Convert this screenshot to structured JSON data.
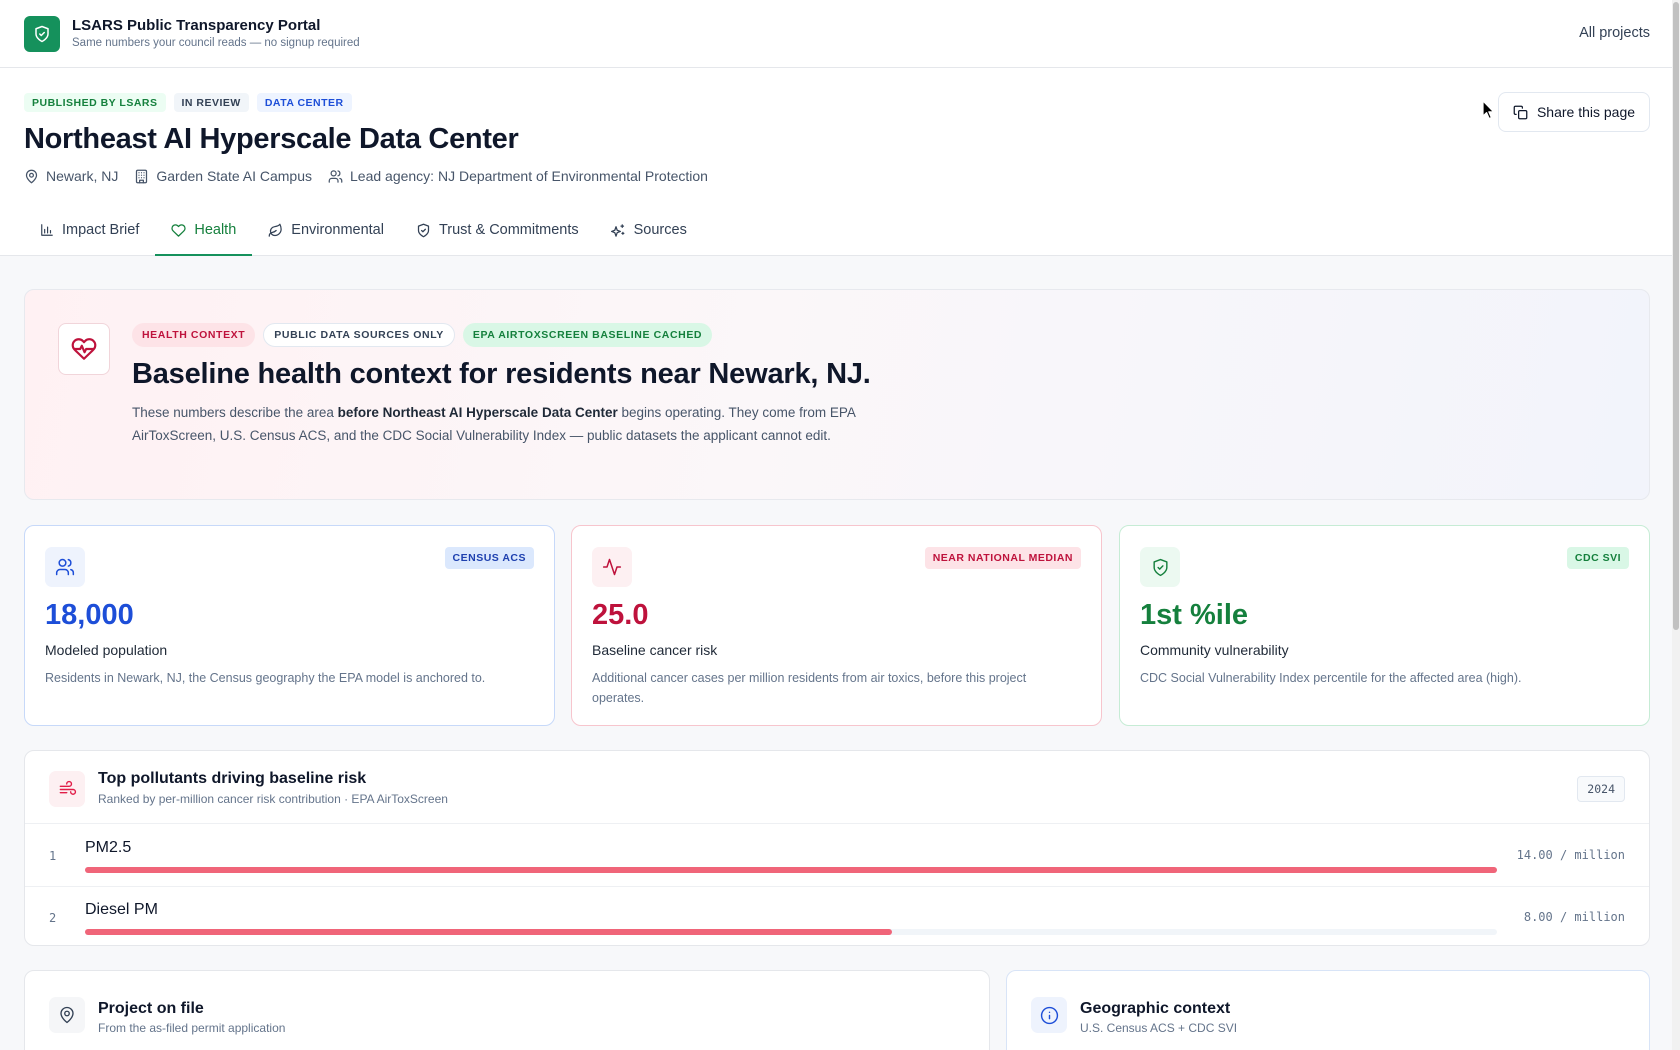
{
  "app": {
    "title": "LSARS Public Transparency Portal",
    "subtitle": "Same numbers your council reads — no signup required",
    "all_projects_link": "All projects"
  },
  "project": {
    "chips": [
      "PUBLISHED BY LSARS",
      "IN REVIEW",
      "DATA CENTER"
    ],
    "title": "Northeast AI Hyperscale Data Center",
    "location": "Newark, NJ",
    "campus": "Garden State AI Campus",
    "lead_agency": "Lead agency: NJ Department of Environmental Protection",
    "share_button": "Share this page"
  },
  "tabs": [
    {
      "label": "Impact Brief",
      "icon": "bar-chart-icon",
      "active": false
    },
    {
      "label": "Health",
      "icon": "heart-icon",
      "active": true
    },
    {
      "label": "Environmental",
      "icon": "leaf-icon",
      "active": false
    },
    {
      "label": "Trust & Commitments",
      "icon": "shield-check-icon",
      "active": false
    },
    {
      "label": "Sources",
      "icon": "sparkles-icon",
      "active": false
    }
  ],
  "hero": {
    "chips": [
      "HEALTH CONTEXT",
      "PUBLIC DATA SOURCES ONLY",
      "EPA AIRTOXSCREEN BASELINE CACHED"
    ],
    "title": "Baseline health context for residents near Newark, NJ.",
    "desc_pre": "These numbers describe the area ",
    "desc_bold": "before Northeast AI Hyperscale Data Center",
    "desc_post": " begins operating. They come from EPA AirToxScreen, U.S. Census ACS, and the CDC Social Vulnerability Index — public datasets the applicant cannot edit."
  },
  "stats": [
    {
      "badge": "CENSUS ACS",
      "value": "18,000",
      "label": "Modeled population",
      "desc": "Residents in Newark, NJ, the Census geography the EPA model is anchored to.",
      "icon": "users-icon",
      "color": "#1d4ed8"
    },
    {
      "badge": "NEAR NATIONAL MEDIAN",
      "value": "25.0",
      "label": "Baseline cancer risk",
      "desc": "Additional cancer cases per million residents from air toxics, before this project operates.",
      "icon": "activity-icon",
      "color": "#be123c"
    },
    {
      "badge": "CDC SVI",
      "value": "1st %ile",
      "label": "Community vulnerability",
      "desc": "CDC Social Vulnerability Index percentile for the affected area (high).",
      "icon": "shield-check-icon",
      "color": "#15803d"
    }
  ],
  "pollutants": {
    "title": "Top pollutants driving baseline risk",
    "subtitle": "Ranked by per-million cancer risk contribution · EPA AirToxScreen",
    "year": "2024",
    "items": [
      {
        "rank": "1",
        "name": "PM2.5",
        "value_label": "14.00 / million",
        "value": 14.0
      },
      {
        "rank": "2",
        "name": "Diesel PM",
        "value_label": "8.00 / million",
        "value": 8.0
      }
    ],
    "bar_color": "#f06579"
  },
  "bottom": {
    "project_on_file": {
      "title": "Project on file",
      "subtitle": "From the as-filed permit application"
    },
    "geographic_context": {
      "title": "Geographic context",
      "subtitle": "U.S. Census ACS + CDC SVI"
    }
  },
  "colors": {
    "brand": "#15915c",
    "accent_red": "#be123c",
    "accent_blue": "#1d4ed8",
    "accent_green": "#15803d"
  }
}
